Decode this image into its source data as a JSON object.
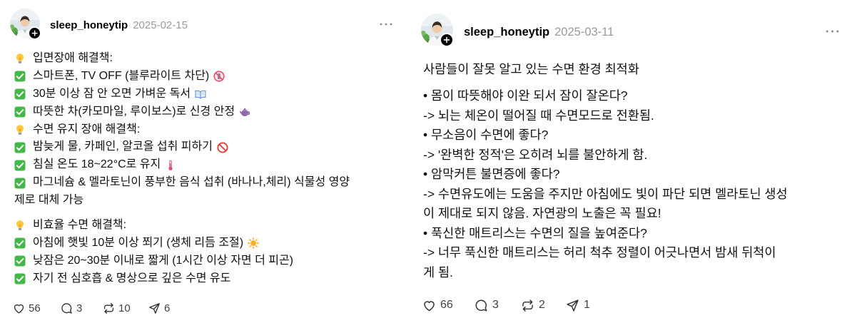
{
  "posts": [
    {
      "username": "sleep_honeytip",
      "date": "2025-02-15",
      "lines": [
        {
          "icon": "lightbulb-icon",
          "text": "입면장애 해결책:"
        },
        {
          "icon": "check-icon",
          "text": "스마트폰, TV OFF (블루라이트 차단)",
          "end_icon": "no-mobile-phones-icon"
        },
        {
          "icon": "check-icon",
          "text": "30분 이상 잠 안 오면 가벼운 독서",
          "end_icon": "open-book-icon"
        },
        {
          "icon": "check-icon",
          "text": "따뜻한 차(카모마일, 루이보스)로 신경 안정",
          "end_icon": "teapot-icon"
        },
        {
          "icon": "lightbulb-icon",
          "text": "수면 유지 장애 해결책:"
        },
        {
          "icon": "check-icon",
          "text": "밤늦게 물, 카페인, 알코올 섭취 피하기",
          "end_icon": "no-entry-icon"
        },
        {
          "icon": "check-icon",
          "text": "침실 온도 18~22°C로 유지",
          "end_icon": "thermometer-icon"
        },
        {
          "icon": "check-icon",
          "text": "마그네슘 & 멜라토닌이 풍부한 음식 섭취 (바나나,체리) 식물성 영양"
        },
        {
          "text": "제로 대체 가능"
        },
        {
          "icon": "lightbulb-icon",
          "text": "비효율 수면 해결책:"
        },
        {
          "icon": "check-icon",
          "text": "아침에 햇빛 10분 이상 쬐기 (생체 리듬 조절)",
          "end_icon": "sun-icon"
        },
        {
          "icon": "check-icon",
          "text": "낮잠은 20~30분 이내로 짧게 (1시간 이상 자면 더 피곤)"
        },
        {
          "icon": "check-icon",
          "text": "자기 전 심호흡 & 명상으로 깊은 수면 유도"
        }
      ],
      "stats": {
        "likes": "56",
        "replies": "3",
        "reposts": "10",
        "shares": "6"
      }
    },
    {
      "username": "sleep_honeytip",
      "date": "2025-03-11",
      "lines": [
        {
          "text": "사람들이 잘못 알고 있는 수면 환경 최적화"
        },
        {
          "text": "• 몸이 따뜻해야 이완 되서 잠이 잘온다?"
        },
        {
          "text": "-> 뇌는 체온이 떨어질 때 수면모드로 전환됨."
        },
        {
          "text": "• 무소음이 수면에 좋다?"
        },
        {
          "text": "-> '완벽한 정적'은 오히려 뇌를 불안하게 함."
        },
        {
          "text": "• 암막커튼 불면증에 좋다?"
        },
        {
          "text": "-> 수면유도에는 도움을 주지만 아침에도 빛이 파단 되면 멜라토닌 생성"
        },
        {
          "text": "이 제대로 되지 않음. 자연광의 노출은 꼭 필요!"
        },
        {
          "text": "• 푹신한 매트리스는 수면의 질을 높여준다?"
        },
        {
          "text": "-> 너무 푹신한 매트리스는 허리 척추 정렬이 어긋나면서 밤새 뒤척이"
        },
        {
          "text": "게 됨."
        }
      ],
      "stats": {
        "likes": "66",
        "replies": "3",
        "reposts": "2",
        "shares": "1"
      }
    }
  ],
  "colors": {
    "text": "#111111",
    "muted": "#9a9a9a",
    "check": "#45b649",
    "action_icon": "#333333",
    "count": "#424242"
  }
}
